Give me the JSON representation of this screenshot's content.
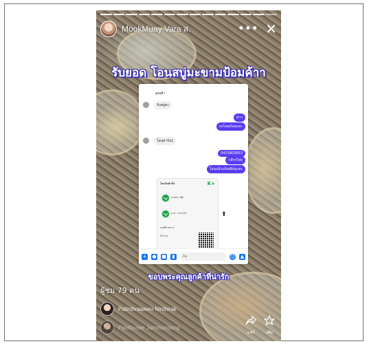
{
  "story": {
    "username": "MookMuay Vara ส.",
    "more_label": "•••",
    "close_label": "✕",
    "headline": "รับยอด โอนสบู่มะขามป้อมค้าา",
    "caption": "ขอบพระคุณลูกค้าที่น่ารัก",
    "views": "ผู้ชม 79 คน",
    "viewers": [
      {
        "name": "Patinthraweeo Ninthirak"
      },
      {
        "name": "Panthunee Jummonpong"
      }
    ],
    "actions": [
      {
        "icon": "share-arrow-icon",
        "label": "แชร์"
      },
      {
        "icon": "star-icon",
        "label": "เพิ่ม"
      }
    ],
    "progress_segments": 14,
    "accent_color": "#5b3df0",
    "text_outline_color": "#3a2fb0"
  },
  "chat": {
    "top_label": "คุณค้า",
    "messages": [
      {
        "side": "in",
        "text": "รับสบู่คะ"
      },
      {
        "side": "out",
        "text": "ค่าา"
      },
      {
        "side": "out",
        "text": "รอโอนเงินนะคะ"
      },
      {
        "side": "in",
        "text": "โอนค่ารับ1"
      },
      {
        "side": "out",
        "text": "0415803653"
      },
      {
        "side": "out",
        "text": "กสิกรไทย"
      },
      {
        "side": "out",
        "text": "โอนแล้วแจ้งสลิปนะคะ"
      }
    ],
    "receipt": {
      "title": "โอนเงินสำเร็จ",
      "brand": "K+",
      "from_name": "นางสาว พิม",
      "to_name": "น.ส. วราภรณ์",
      "ref_label": "เลขที่รายการ",
      "amount_label": "จำนวน"
    },
    "input_placeholder": "Aa"
  }
}
